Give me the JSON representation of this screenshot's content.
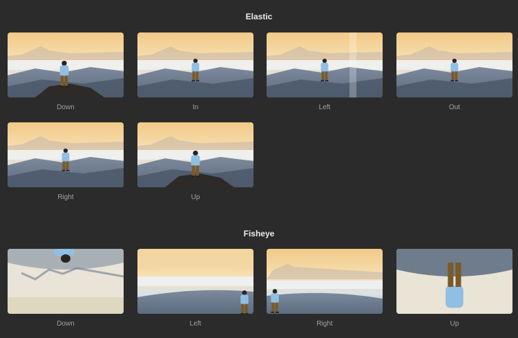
{
  "sections": [
    {
      "title": "Elastic",
      "items": [
        {
          "label": "Down",
          "variant": "normal",
          "person": "left",
          "rock": true
        },
        {
          "label": "In",
          "variant": "normal",
          "person": "center",
          "rock": false
        },
        {
          "label": "Left",
          "variant": "seam",
          "person": "center",
          "rock": false
        },
        {
          "label": "Out",
          "variant": "normal",
          "person": "center",
          "rock": false
        },
        {
          "label": "Right",
          "variant": "normal",
          "person": "center",
          "rock": false
        },
        {
          "label": "Up",
          "variant": "normal",
          "person": "center",
          "rock": true
        }
      ]
    },
    {
      "title": "Fisheye",
      "items": [
        {
          "label": "Down",
          "variant": "fisheye-down"
        },
        {
          "label": "Left",
          "variant": "fisheye-left"
        },
        {
          "label": "Right",
          "variant": "fisheye-right"
        },
        {
          "label": "Up",
          "variant": "fisheye-up"
        }
      ]
    }
  ],
  "colors": {
    "background": "#2b2b2b",
    "title": "#ececec",
    "caption": "#a3a3a3",
    "sky_top": "#f2c987",
    "sky_mid": "#f6e1b5",
    "haze": "#d9e1e8",
    "mountain": "#5d6b80",
    "jacket": "#8fbfe3",
    "pants": "#7a5a2a"
  }
}
